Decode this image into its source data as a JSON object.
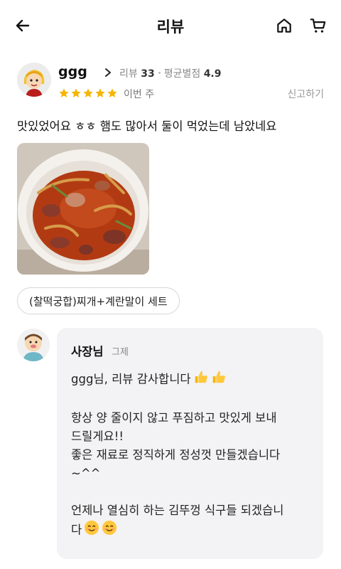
{
  "header": {
    "title": "리뷰",
    "icons": {
      "back": "arrow-left-icon",
      "home": "home-icon",
      "cart": "cart-icon"
    }
  },
  "review": {
    "username": "ggg",
    "review_count_label": "리뷰",
    "review_count": "33",
    "avg_label": "평균별점",
    "avg_rating": "4.9",
    "stars": 5,
    "star_color": "#f5b500",
    "date": "이번 주",
    "report_label": "신고하기",
    "text": "맛있었어요 ㅎㅎ 햄도 많아서 둘이 먹었는데 남았네요",
    "menu": "(찰떡궁합)찌개+계란말이 세트"
  },
  "owner_reply": {
    "name": "사장님",
    "date": "그제",
    "lines": [
      "ggg님, 리뷰 감사합니다",
      "",
      "항상 양 줄이지 않고 푸짐하고 맛있게 보내",
      "드릴게요!!",
      "좋은 재료로 정직하게 정성껏 만들겠습니다",
      "~^^",
      "",
      "언제나 열심히 하는 김뚜껑 식구들 되겠습니",
      "다"
    ],
    "emojis": {
      "thanks": "thumbs-up-icon",
      "end": "smile-icon"
    }
  }
}
